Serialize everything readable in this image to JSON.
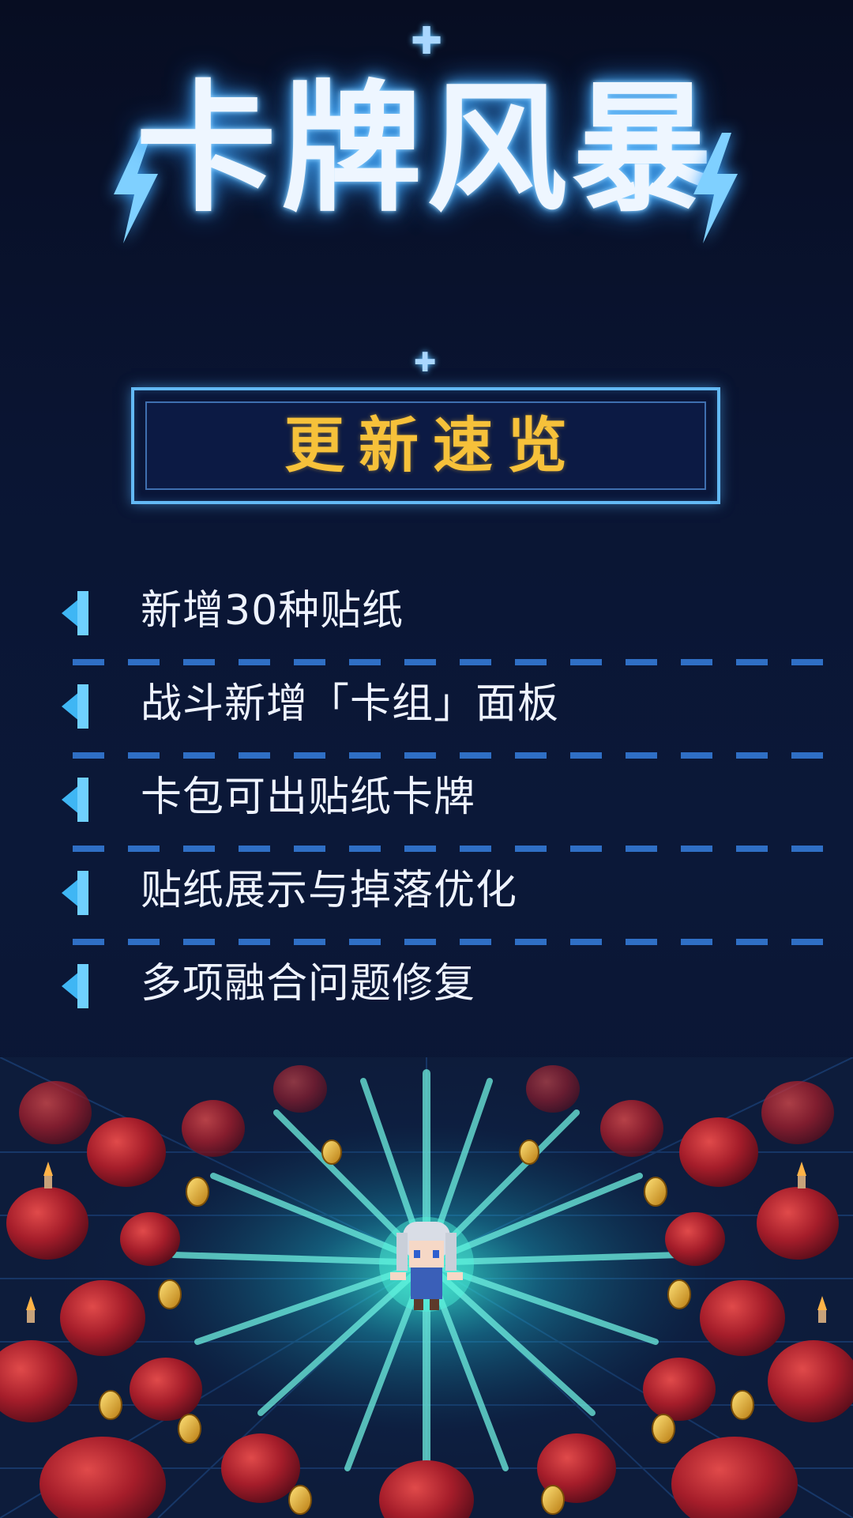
{
  "title": "卡牌风暴",
  "section": {
    "title": "更新速览"
  },
  "items": [
    {
      "label": "新增30种贴纸"
    },
    {
      "label": "战斗新增「卡组」面板"
    },
    {
      "label": "卡包可出贴纸卡牌"
    },
    {
      "label": "贴纸展示与掉落优化"
    },
    {
      "label": "多项融合问题修复"
    }
  ],
  "colors": {
    "background": "#0b1430",
    "title_glow": "#4fb3ff",
    "section_title": "#f6c13a",
    "accent": "#63b9f5",
    "bullet": "#3fb6f4",
    "divider": "#2f6fc5"
  },
  "icons": {
    "sparkle": "sparkle-icon",
    "bolt": "lightning-bolt-icon",
    "bullet": "triangle-bullet-icon"
  }
}
